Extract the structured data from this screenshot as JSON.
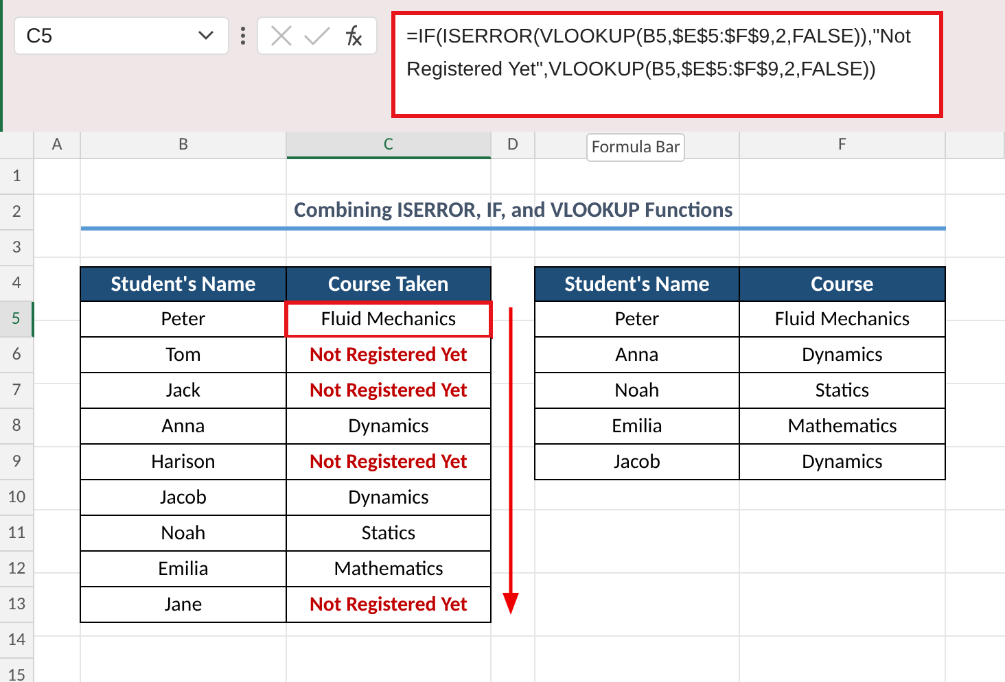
{
  "name_box": "C5",
  "formula": "=IF(ISERROR(VLOOKUP(B5,$E$5:$F$9,2,FALSE)),\"Not Registered Yet\",VLOOKUP(B5,$E$5:$F$9,2,FALSE))",
  "tooltip": "Formula Bar",
  "column_headers": [
    {
      "label": "A",
      "selected": false
    },
    {
      "label": "B",
      "selected": false
    },
    {
      "label": "C",
      "selected": true
    },
    {
      "label": "D",
      "selected": false
    },
    {
      "selected": false
    },
    {
      "label": "F",
      "selected": false
    }
  ],
  "row_headers": [
    {
      "label": "1",
      "selected": false
    },
    {
      "label": "2",
      "selected": false
    },
    {
      "label": "3",
      "selected": false
    },
    {
      "label": "4",
      "selected": false
    },
    {
      "label": "5",
      "selected": true
    },
    {
      "label": "6",
      "selected": false
    },
    {
      "label": "7",
      "selected": false
    },
    {
      "label": "8",
      "selected": false
    },
    {
      "label": "9",
      "selected": false
    },
    {
      "label": "10",
      "selected": false
    },
    {
      "label": "11",
      "selected": false
    },
    {
      "label": "12",
      "selected": false
    },
    {
      "label": "13",
      "selected": false
    },
    {
      "label": "14",
      "selected": false
    },
    {
      "label": "15",
      "selected": false
    }
  ],
  "title": "Combining ISERROR, IF, and VLOOKUP Functions",
  "result_table": {
    "columns": [
      "Student's Name",
      "Course Taken"
    ],
    "rows": [
      {
        "name": "Peter",
        "course": "Fluid Mechanics",
        "not_found": false,
        "selected": true
      },
      {
        "name": "Tom",
        "course": "Not Registered Yet",
        "not_found": true,
        "selected": false
      },
      {
        "name": "Jack",
        "course": "Not Registered Yet",
        "not_found": true,
        "selected": false
      },
      {
        "name": "Anna",
        "course": "Dynamics",
        "not_found": false,
        "selected": false
      },
      {
        "name": "Harison",
        "course": "Not Registered Yet",
        "not_found": true,
        "selected": false
      },
      {
        "name": "Jacob",
        "course": "Dynamics",
        "not_found": false,
        "selected": false
      },
      {
        "name": "Noah",
        "course": "Statics",
        "not_found": false,
        "selected": false
      },
      {
        "name": "Emilia",
        "course": "Mathematics",
        "not_found": false,
        "selected": false
      },
      {
        "name": "Jane",
        "course": "Not Registered Yet",
        "not_found": true,
        "selected": false
      }
    ]
  },
  "lookup_table": {
    "columns": [
      "Student's Name",
      "Course"
    ],
    "rows": [
      {
        "name": "Peter",
        "course": "Fluid Mechanics"
      },
      {
        "name": "Anna",
        "course": "Dynamics"
      },
      {
        "name": "Noah",
        "course": "Statics"
      },
      {
        "name": "Emilia",
        "course": "Mathematics"
      },
      {
        "name": "Jacob",
        "course": "Dynamics"
      }
    ]
  }
}
